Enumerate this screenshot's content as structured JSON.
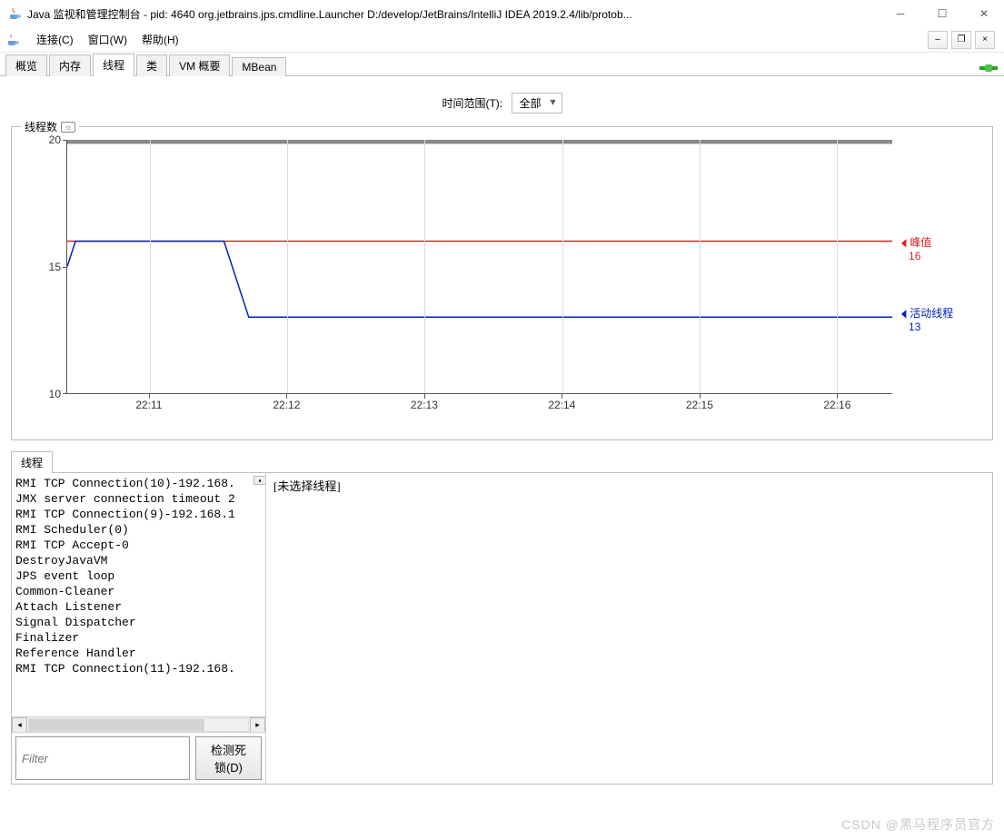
{
  "window": {
    "title": "Java 监视和管理控制台 - pid: 4640 org.jetbrains.jps.cmdline.Launcher D:/develop/JetBrains/IntelliJ IDEA 2019.2.4/lib/protob..."
  },
  "menu": {
    "connect": "连接(C)",
    "window": "窗口(W)",
    "help": "帮助(H)"
  },
  "tabs": {
    "overview": "概览",
    "memory": "内存",
    "threads": "线程",
    "classes": "类",
    "vm": "VM 概要",
    "mbean": "MBean"
  },
  "range": {
    "label": "时间范围(T):",
    "value": "全部"
  },
  "chart": {
    "title": "线程数",
    "collapse": "⌃"
  },
  "chart_data": {
    "type": "line",
    "title": "线程数",
    "xlabel": "",
    "ylabel": "",
    "y_ticks": [
      10,
      15,
      20
    ],
    "x_ticks": [
      "22:11",
      "22:12",
      "22:13",
      "22:14",
      "22:15",
      "22:16"
    ],
    "ylim": [
      10,
      20
    ],
    "series": [
      {
        "name": "峰值",
        "label_value": "16",
        "color": "#e02020",
        "points": [
          [
            0,
            16
          ],
          [
            100,
            16
          ]
        ]
      },
      {
        "name": "活动线程",
        "label_value": "13",
        "color": "#0020c0",
        "points": [
          [
            0,
            15
          ],
          [
            1,
            16
          ],
          [
            19,
            16
          ],
          [
            22,
            13
          ],
          [
            100,
            13
          ]
        ]
      }
    ]
  },
  "right_legend": {
    "peak_label": "峰值",
    "peak_value": "16",
    "live_label": "活动线程",
    "live_value": "13"
  },
  "threads_tab": "线程",
  "threads_list": [
    "RMI TCP Connection(10)-192.168.",
    "JMX server connection timeout 2",
    "RMI TCP Connection(9)-192.168.1",
    "RMI Scheduler(0)",
    "RMI TCP Accept-0",
    "DestroyJavaVM",
    "JPS event loop",
    "Common-Cleaner",
    "Attach Listener",
    "Signal Dispatcher",
    "Finalizer",
    "Reference Handler",
    "RMI TCP Connection(11)-192.168."
  ],
  "detail_placeholder": "[未选择线程]",
  "filter_placeholder": "Filter",
  "detect_btn": "检测死锁(D)",
  "watermark": "CSDN @黑马程序员官方"
}
